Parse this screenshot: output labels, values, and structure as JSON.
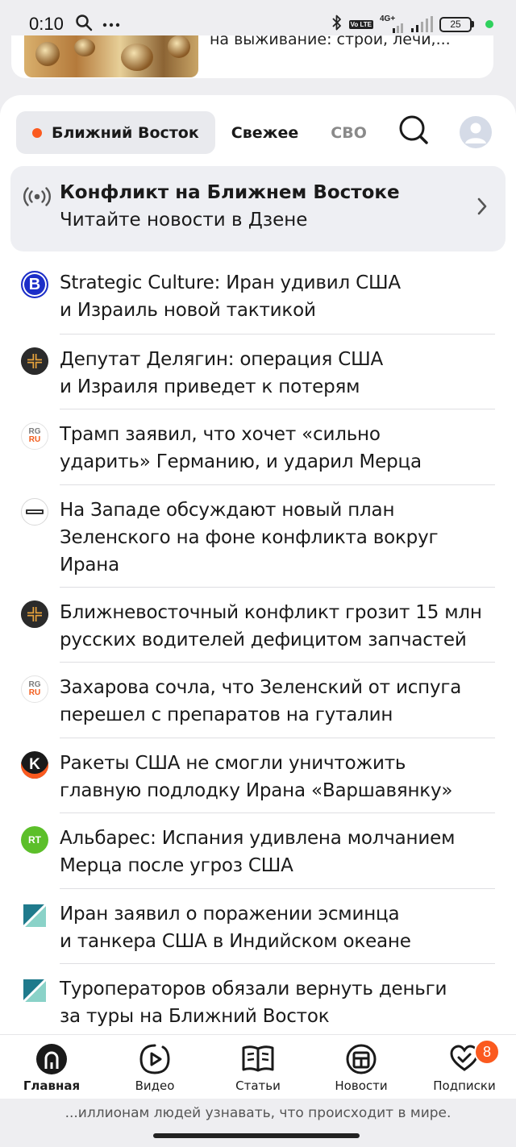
{
  "status_bar": {
    "time": "0:10",
    "battery": "25",
    "network": "4G+",
    "lte": "Vo LTE"
  },
  "promo": {
    "text": "на выживание: строй, лечи,..."
  },
  "tabs": [
    {
      "label": "Ближний Восток",
      "active": true,
      "dot_color": "#fb5a1f"
    },
    {
      "label": "Свежее",
      "active": false
    },
    {
      "label": "СВО",
      "active": false
    }
  ],
  "banner": {
    "title": "Конфликт на Ближнем Востоке",
    "subtitle": "Читайте новости в Дзене",
    "icon": "broadcast-icon"
  },
  "news": [
    {
      "source_logo": "B",
      "text_line1": "Strategic Culture: Иран удивил США",
      "text_line2": "и Израиль новой тактикой"
    },
    {
      "source_logo": "plus",
      "text_line1": "Депутат Делягин: операция США",
      "text_line2": "и Израиля приведет к потерям"
    },
    {
      "source_logo": "RG RU",
      "text_line1": "Трамп заявил, что хочет «сильно",
      "text_line2": "ударить» Германию, и ударил Мерца"
    },
    {
      "source_logo": "mk",
      "text_line1": "На Западе обсуждают новый план",
      "text_line2": "Зеленского на фоне конфликта вокруг",
      "text_line3": "Ирана"
    },
    {
      "source_logo": "plus",
      "text_line1": "Ближневосточный конфликт грозит 15 млн",
      "text_line2": "русских водителей дефицитом запчастей"
    },
    {
      "source_logo": "RG RU",
      "text_line1": "Захарова сочла, что Зеленский от испуга",
      "text_line2": "перешел с препаратов на гуталин"
    },
    {
      "source_logo": "K",
      "text_line1": "Ракеты США не смогли уничтожить",
      "text_line2": "главную подлодку Ирана «Варшавянку»"
    },
    {
      "source_logo": "RT",
      "text_line1": "Альбарес: Испания удивлена молчанием",
      "text_line2": "Мерца после угроз США"
    },
    {
      "source_logo": "square",
      "text_line1": "Иран заявил о поражении эсминца",
      "text_line2": "и танкера США в Индийском океане"
    },
    {
      "source_logo": "square",
      "text_line1": "Туроператоров обязали вернуть деньги",
      "text_line2": "за туры на Ближний Восток"
    }
  ],
  "bottom_nav": [
    {
      "label": "Главная",
      "icon": "home-icon",
      "active": true
    },
    {
      "label": "Видео",
      "icon": "video-icon",
      "active": false
    },
    {
      "label": "Статьи",
      "icon": "articles-icon",
      "active": false
    },
    {
      "label": "Новости",
      "icon": "news-icon",
      "active": false
    },
    {
      "label": "Подписки",
      "icon": "subscriptions-icon",
      "active": false,
      "badge": "8"
    }
  ],
  "ticker": {
    "text": "...иллионам людей узнавать, что происходит в мире."
  },
  "colors": {
    "accent": "#fb5a1f",
    "background": "#eeeef1",
    "sheet": "#ffffff"
  }
}
